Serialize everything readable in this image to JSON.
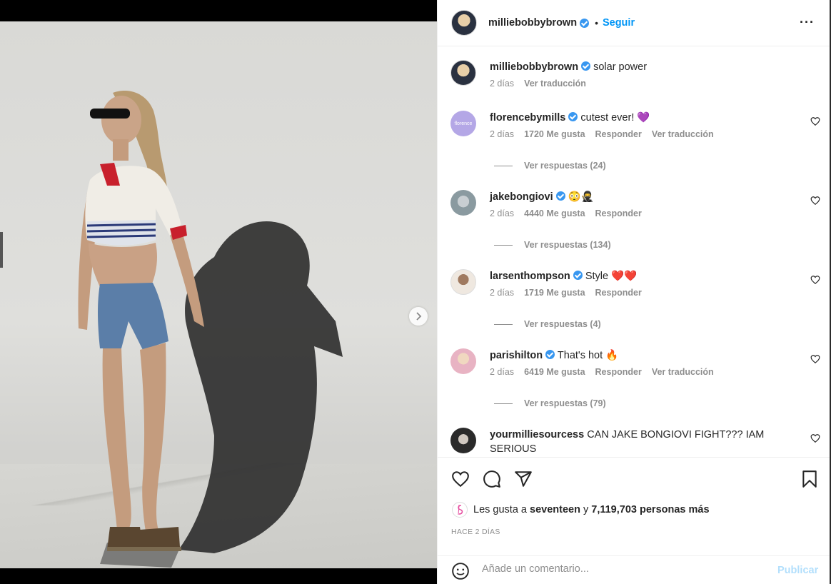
{
  "post": {
    "author": "milliebobbybrown",
    "follow_label": "Seguir",
    "bullet": "•",
    "caption": {
      "user": "milliebobbybrown",
      "text": "solar power",
      "time": "2 días",
      "translate": "Ver traducción"
    },
    "carousel": {
      "slides": 3,
      "active_slide": 1
    }
  },
  "comments": [
    {
      "user": "florencebymills",
      "text": "cutest ever!",
      "emoji": "💜",
      "time": "2 días",
      "likes": "1720 Me gusta",
      "reply": "Responder",
      "translate": "Ver traducción",
      "view_replies": "Ver respuestas (24)",
      "avatar_text": "florence",
      "avatar_color": "#b4a7e6"
    },
    {
      "user": "jakebongiovi",
      "text": "",
      "emoji": "😳🥷",
      "time": "2 días",
      "likes": "4440 Me gusta",
      "reply": "Responder",
      "translate": "",
      "view_replies": "Ver respuestas (134)",
      "avatar_color": "#8a9aa0"
    },
    {
      "user": "larsenthompson",
      "text": "Style",
      "emoji": "❤️❤️",
      "time": "2 días",
      "likes": "1719 Me gusta",
      "reply": "Responder",
      "translate": "",
      "view_replies": "Ver respuestas (4)",
      "avatar_color": "#6b4a3a"
    },
    {
      "user": "parishilton",
      "text": "That's hot",
      "emoji": "🔥",
      "time": "2 días",
      "likes": "6419 Me gusta",
      "reply": "Responder",
      "translate": "Ver traducción",
      "view_replies": "Ver respuestas (79)",
      "avatar_color": "#e8b3c3"
    },
    {
      "user": "yourmilliesourcess",
      "text": "CAN JAKE BONGIOVI FIGHT??? IAM SERIOUS",
      "emoji": "",
      "avatar_color": "#3a3a3a"
    }
  ],
  "likes": {
    "prefix": "Les gusta a",
    "user": "seventeen",
    "conjunction": "y",
    "others": "7,119,703 personas más"
  },
  "posted_ago": "HACE 2 DÍAS",
  "add_comment": {
    "placeholder": "Añade un comentario...",
    "publish_label": "Publicar"
  },
  "colors": {
    "link_blue": "#0095f6",
    "verified_blue": "#3897f0",
    "muted_text": "#8e8e8e",
    "publish_disabled": "#b2dffc"
  },
  "icons": [
    "more-options-icon",
    "verified-icon",
    "heart-icon",
    "comment-icon",
    "share-icon",
    "bookmark-icon",
    "emoji-icon",
    "chevron-right-icon"
  ]
}
